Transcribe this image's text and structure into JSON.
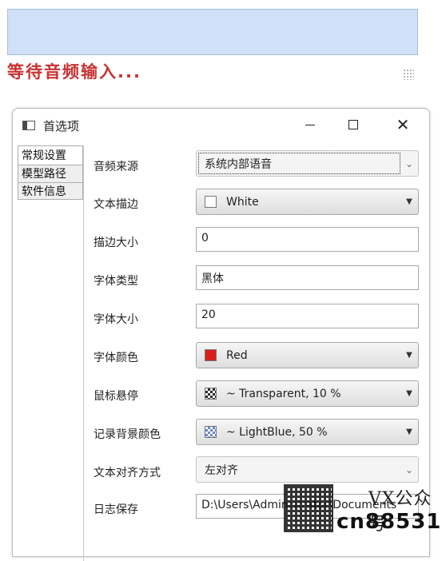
{
  "status": {
    "waiting_text": "等待音频输入..."
  },
  "window": {
    "title": "首选项",
    "controls": {
      "minimize": "—",
      "maximize": "☐",
      "close": "✕"
    }
  },
  "tabs": [
    {
      "label": "常规设置",
      "active": true
    },
    {
      "label": "模型路径",
      "active": false
    },
    {
      "label": "软件信息",
      "active": false
    }
  ],
  "settings": {
    "audio_source": {
      "label": "音频来源",
      "value": "系统内部语音"
    },
    "text_stroke": {
      "label": "文本描边",
      "value": "White",
      "swatch_color": "#ffffff"
    },
    "stroke_size": {
      "label": "描边大小",
      "value": "0"
    },
    "font_type": {
      "label": "字体类型",
      "value": "黑体"
    },
    "font_size": {
      "label": "字体大小",
      "value": "20"
    },
    "font_color": {
      "label": "字体颜色",
      "value": "Red",
      "swatch_color": "#d8211b"
    },
    "mouse_hover": {
      "label": "鼠标悬停",
      "value": "~ Transparent, 10 %"
    },
    "record_bg_color": {
      "label": "记录背景颜色",
      "value": "~ LightBlue, 50 %"
    },
    "text_align": {
      "label": "文本对齐方式",
      "value": "左对齐"
    },
    "log_save": {
      "label": "日志保存",
      "value": "D:\\Users\\Administrator\\Documents"
    }
  },
  "watermark": {
    "brand": "VX公众号",
    "id": "cn88531"
  },
  "colors": {
    "accent_red": "#c83232",
    "top_bar": "#cfe0f7"
  }
}
